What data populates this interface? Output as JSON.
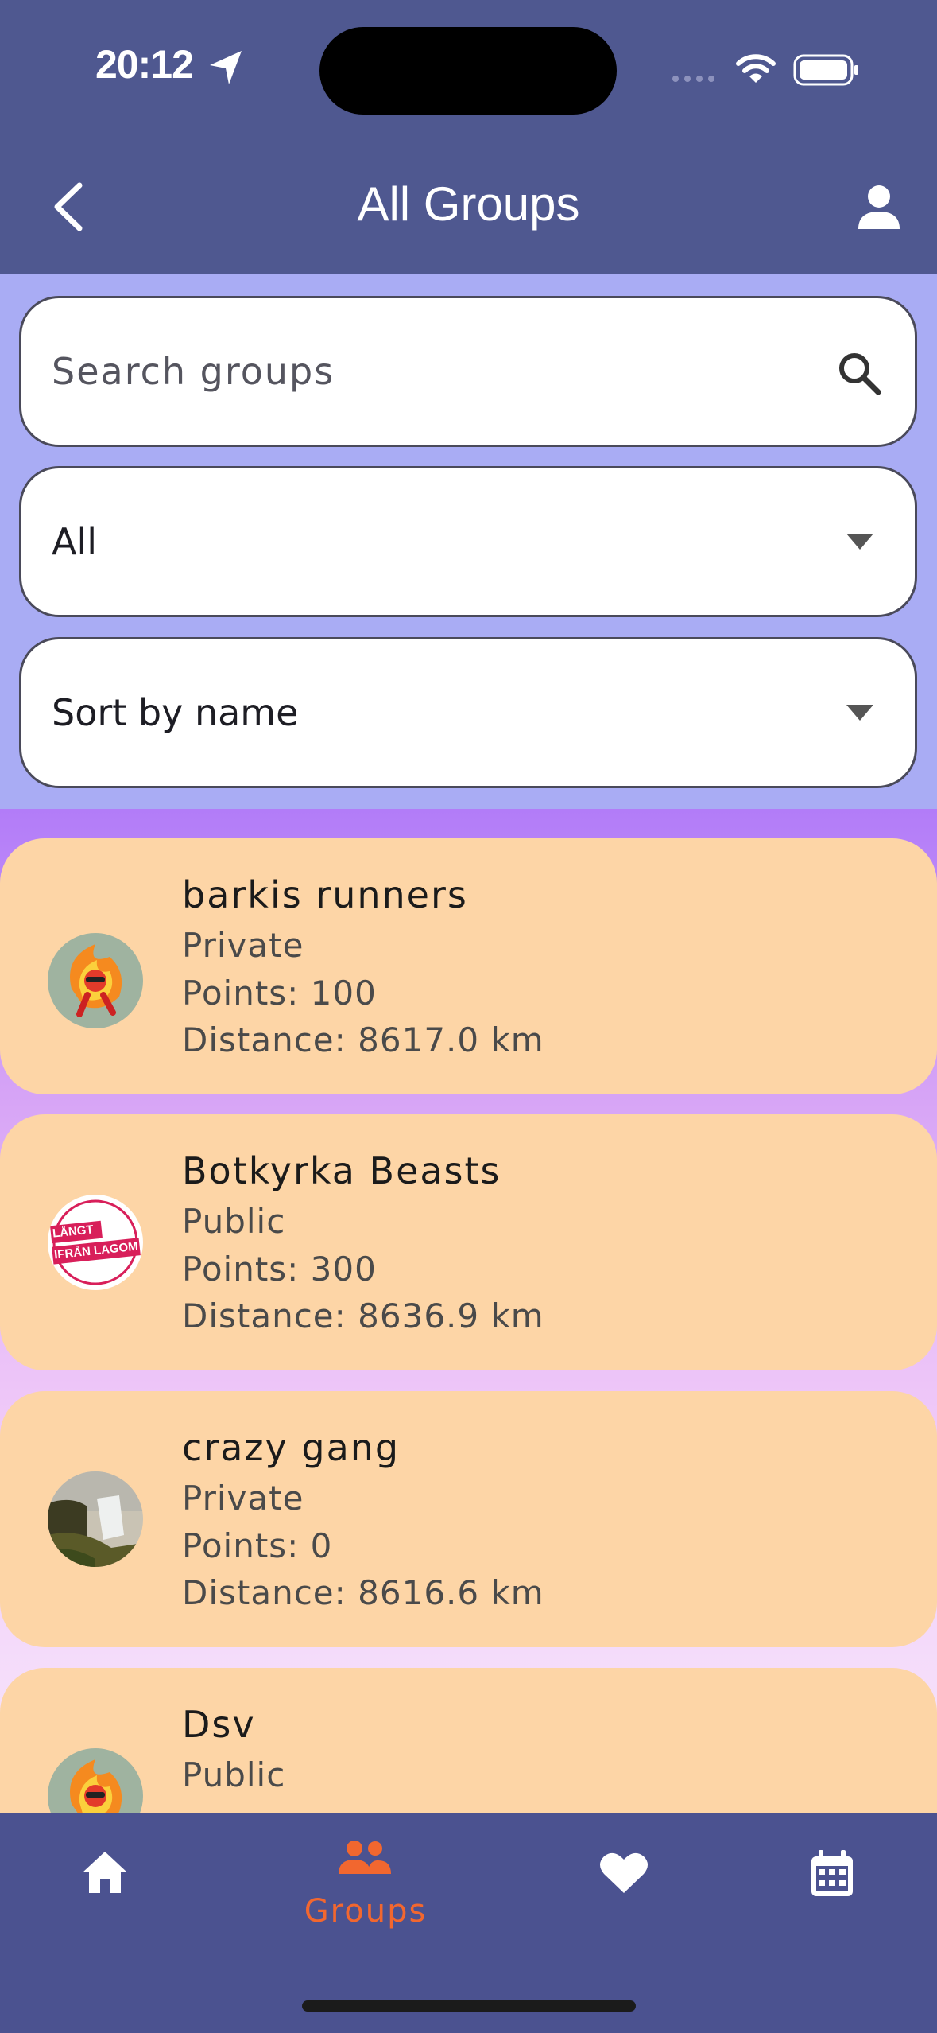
{
  "status_bar": {
    "time": "20:12"
  },
  "header": {
    "title": "All Groups"
  },
  "search": {
    "placeholder": "Search groups"
  },
  "filter": {
    "selected": "All"
  },
  "sort": {
    "selected": "Sort by name"
  },
  "groups": [
    {
      "name": "barkis runners",
      "visibility": "Private",
      "points": "Points: 100",
      "distance": "Distance: 8617.0 km",
      "avatar": "fire-runner-avatar"
    },
    {
      "name": "Botkyrka Beasts",
      "visibility": "Public",
      "points": "Points: 300",
      "distance": "Distance: 8636.9 km",
      "avatar": "langt-ifran-lagom-stamp-avatar"
    },
    {
      "name": "crazy gang",
      "visibility": "Private",
      "points": "Points: 0",
      "distance": "Distance: 8616.6 km",
      "avatar": "waterfall-photo-avatar"
    },
    {
      "name": "Dsv",
      "visibility": "Public",
      "points": "",
      "distance": "",
      "avatar": "fire-runner-avatar"
    }
  ],
  "stamp_text": {
    "line1": "LÅNGT",
    "line2": "IFRÅN LAGOM"
  },
  "nav": {
    "items": [
      {
        "icon": "home-icon",
        "label": ""
      },
      {
        "icon": "groups-icon",
        "label": "Groups",
        "active": true
      },
      {
        "icon": "heart-icon",
        "label": ""
      },
      {
        "icon": "calendar-icon",
        "label": ""
      }
    ]
  },
  "colors": {
    "header_bg": "#4f5890",
    "controls_bg": "#a9acf4",
    "card_bg": "#fdd5a6",
    "active_nav": "#f2672f"
  }
}
